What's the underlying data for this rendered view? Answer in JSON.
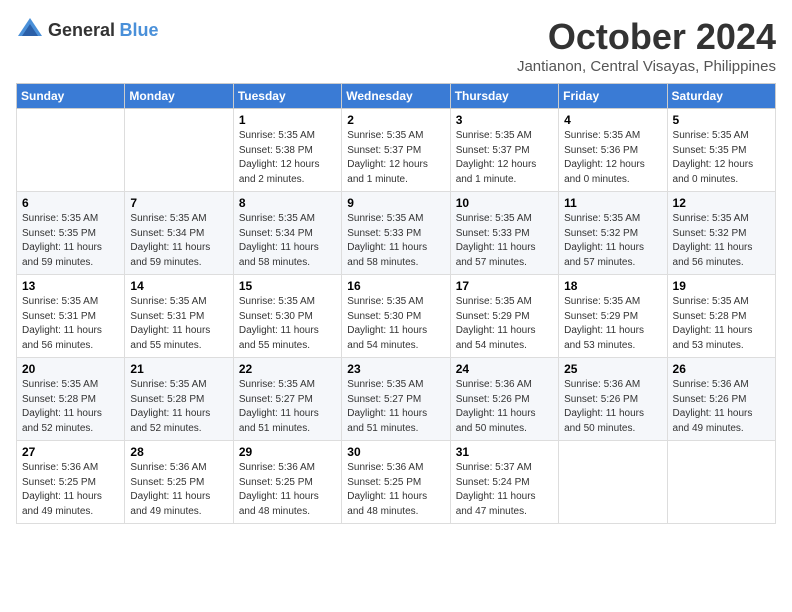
{
  "logo": {
    "general": "General",
    "blue": "Blue"
  },
  "header": {
    "month": "October 2024",
    "location": "Jantianon, Central Visayas, Philippines"
  },
  "weekdays": [
    "Sunday",
    "Monday",
    "Tuesday",
    "Wednesday",
    "Thursday",
    "Friday",
    "Saturday"
  ],
  "weeks": [
    [
      {
        "day": null,
        "info": null
      },
      {
        "day": null,
        "info": null
      },
      {
        "day": "1",
        "info": "Sunrise: 5:35 AM\nSunset: 5:38 PM\nDaylight: 12 hours\nand 2 minutes."
      },
      {
        "day": "2",
        "info": "Sunrise: 5:35 AM\nSunset: 5:37 PM\nDaylight: 12 hours\nand 1 minute."
      },
      {
        "day": "3",
        "info": "Sunrise: 5:35 AM\nSunset: 5:37 PM\nDaylight: 12 hours\nand 1 minute."
      },
      {
        "day": "4",
        "info": "Sunrise: 5:35 AM\nSunset: 5:36 PM\nDaylight: 12 hours\nand 0 minutes."
      },
      {
        "day": "5",
        "info": "Sunrise: 5:35 AM\nSunset: 5:35 PM\nDaylight: 12 hours\nand 0 minutes."
      }
    ],
    [
      {
        "day": "6",
        "info": "Sunrise: 5:35 AM\nSunset: 5:35 PM\nDaylight: 11 hours\nand 59 minutes."
      },
      {
        "day": "7",
        "info": "Sunrise: 5:35 AM\nSunset: 5:34 PM\nDaylight: 11 hours\nand 59 minutes."
      },
      {
        "day": "8",
        "info": "Sunrise: 5:35 AM\nSunset: 5:34 PM\nDaylight: 11 hours\nand 58 minutes."
      },
      {
        "day": "9",
        "info": "Sunrise: 5:35 AM\nSunset: 5:33 PM\nDaylight: 11 hours\nand 58 minutes."
      },
      {
        "day": "10",
        "info": "Sunrise: 5:35 AM\nSunset: 5:33 PM\nDaylight: 11 hours\nand 57 minutes."
      },
      {
        "day": "11",
        "info": "Sunrise: 5:35 AM\nSunset: 5:32 PM\nDaylight: 11 hours\nand 57 minutes."
      },
      {
        "day": "12",
        "info": "Sunrise: 5:35 AM\nSunset: 5:32 PM\nDaylight: 11 hours\nand 56 minutes."
      }
    ],
    [
      {
        "day": "13",
        "info": "Sunrise: 5:35 AM\nSunset: 5:31 PM\nDaylight: 11 hours\nand 56 minutes."
      },
      {
        "day": "14",
        "info": "Sunrise: 5:35 AM\nSunset: 5:31 PM\nDaylight: 11 hours\nand 55 minutes."
      },
      {
        "day": "15",
        "info": "Sunrise: 5:35 AM\nSunset: 5:30 PM\nDaylight: 11 hours\nand 55 minutes."
      },
      {
        "day": "16",
        "info": "Sunrise: 5:35 AM\nSunset: 5:30 PM\nDaylight: 11 hours\nand 54 minutes."
      },
      {
        "day": "17",
        "info": "Sunrise: 5:35 AM\nSunset: 5:29 PM\nDaylight: 11 hours\nand 54 minutes."
      },
      {
        "day": "18",
        "info": "Sunrise: 5:35 AM\nSunset: 5:29 PM\nDaylight: 11 hours\nand 53 minutes."
      },
      {
        "day": "19",
        "info": "Sunrise: 5:35 AM\nSunset: 5:28 PM\nDaylight: 11 hours\nand 53 minutes."
      }
    ],
    [
      {
        "day": "20",
        "info": "Sunrise: 5:35 AM\nSunset: 5:28 PM\nDaylight: 11 hours\nand 52 minutes."
      },
      {
        "day": "21",
        "info": "Sunrise: 5:35 AM\nSunset: 5:28 PM\nDaylight: 11 hours\nand 52 minutes."
      },
      {
        "day": "22",
        "info": "Sunrise: 5:35 AM\nSunset: 5:27 PM\nDaylight: 11 hours\nand 51 minutes."
      },
      {
        "day": "23",
        "info": "Sunrise: 5:35 AM\nSunset: 5:27 PM\nDaylight: 11 hours\nand 51 minutes."
      },
      {
        "day": "24",
        "info": "Sunrise: 5:36 AM\nSunset: 5:26 PM\nDaylight: 11 hours\nand 50 minutes."
      },
      {
        "day": "25",
        "info": "Sunrise: 5:36 AM\nSunset: 5:26 PM\nDaylight: 11 hours\nand 50 minutes."
      },
      {
        "day": "26",
        "info": "Sunrise: 5:36 AM\nSunset: 5:26 PM\nDaylight: 11 hours\nand 49 minutes."
      }
    ],
    [
      {
        "day": "27",
        "info": "Sunrise: 5:36 AM\nSunset: 5:25 PM\nDaylight: 11 hours\nand 49 minutes."
      },
      {
        "day": "28",
        "info": "Sunrise: 5:36 AM\nSunset: 5:25 PM\nDaylight: 11 hours\nand 49 minutes."
      },
      {
        "day": "29",
        "info": "Sunrise: 5:36 AM\nSunset: 5:25 PM\nDaylight: 11 hours\nand 48 minutes."
      },
      {
        "day": "30",
        "info": "Sunrise: 5:36 AM\nSunset: 5:25 PM\nDaylight: 11 hours\nand 48 minutes."
      },
      {
        "day": "31",
        "info": "Sunrise: 5:37 AM\nSunset: 5:24 PM\nDaylight: 11 hours\nand 47 minutes."
      },
      {
        "day": null,
        "info": null
      },
      {
        "day": null,
        "info": null
      }
    ]
  ]
}
